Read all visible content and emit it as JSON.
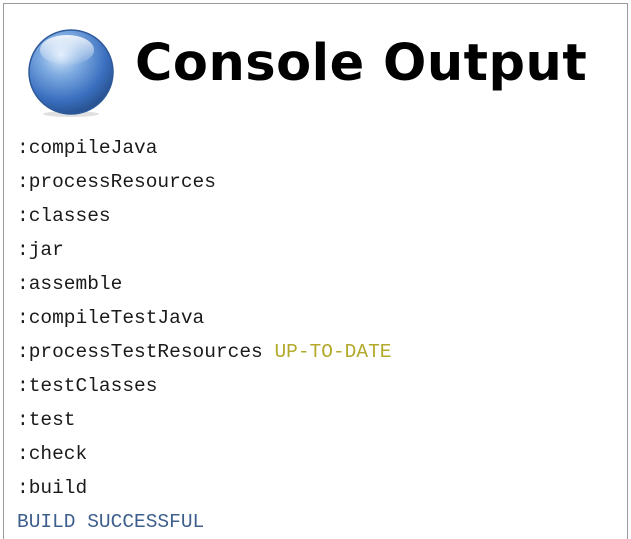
{
  "header": {
    "title": "Console Output",
    "icon": "console-globe-icon"
  },
  "console": {
    "lines": [
      {
        "task": ":compileJava",
        "status": ""
      },
      {
        "task": ":processResources",
        "status": ""
      },
      {
        "task": ":classes",
        "status": ""
      },
      {
        "task": ":jar",
        "status": ""
      },
      {
        "task": ":assemble",
        "status": ""
      },
      {
        "task": ":compileTestJava",
        "status": ""
      },
      {
        "task": ":processTestResources",
        "status": "UP-TO-DATE"
      },
      {
        "task": ":testClasses",
        "status": ""
      },
      {
        "task": ":test",
        "status": ""
      },
      {
        "task": ":check",
        "status": ""
      },
      {
        "task": ":build",
        "status": ""
      }
    ],
    "result": "BUILD SUCCESSFUL"
  },
  "colors": {
    "uptodate": "#b3a92a",
    "result": "#3d5f8d",
    "text": "#1a1a1a"
  }
}
